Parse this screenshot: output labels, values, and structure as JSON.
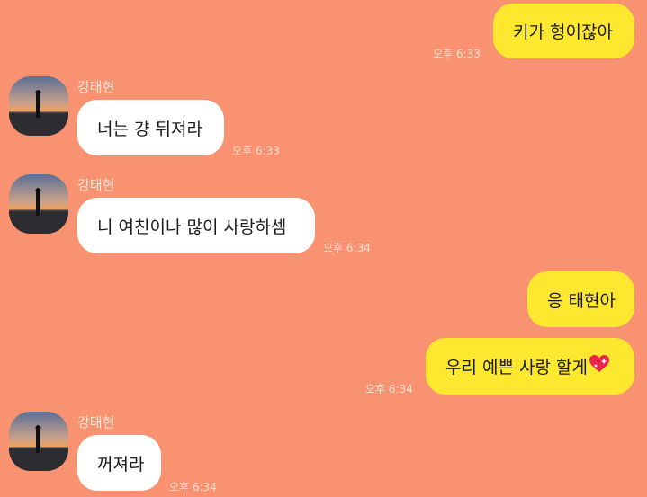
{
  "messages": [
    {
      "id": "m1",
      "sender": "me",
      "text": "키가 형이잖아",
      "time": "오후 6:33"
    },
    {
      "id": "m2",
      "sender": "강태현",
      "text": "너는 걍 뒤져라",
      "time": "오후 6:33"
    },
    {
      "id": "m3",
      "sender": "강태현",
      "text": "니 여친이나 많이 사랑하셈",
      "time": "오후 6:34"
    },
    {
      "id": "m4",
      "sender": "me",
      "text": "응 태현아",
      "time": ""
    },
    {
      "id": "m5",
      "sender": "me",
      "text": "우리 예쁜 사랑 할게",
      "emoji": "sparkling-heart",
      "time": "오후 6:34"
    },
    {
      "id": "m6",
      "sender": "강태현",
      "text": "꺼져라",
      "time": "오후 6:34"
    }
  ],
  "colors": {
    "background": "#f99271",
    "my_bubble": "#fde82f",
    "their_bubble": "#ffffff"
  }
}
